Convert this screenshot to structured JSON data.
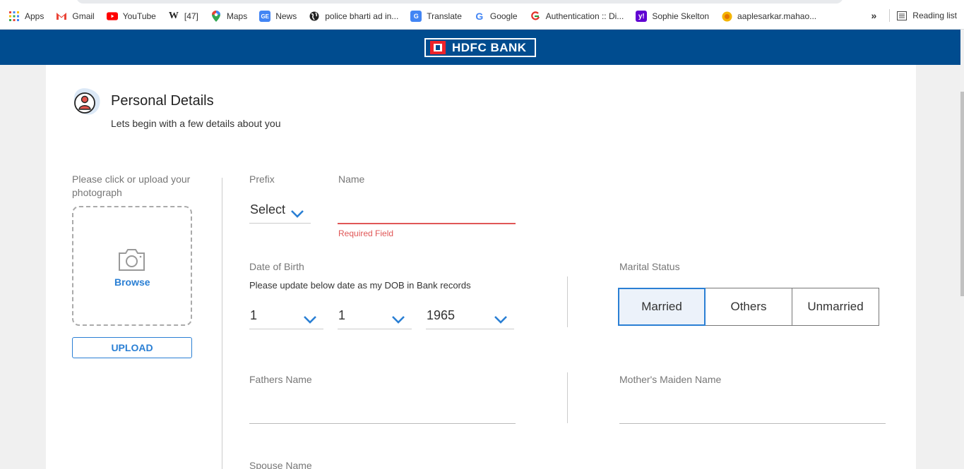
{
  "bookmarks": {
    "items": [
      {
        "label": "Apps",
        "icon": "apps-grid-icon"
      },
      {
        "label": "Gmail",
        "icon": "gmail-icon"
      },
      {
        "label": "YouTube",
        "icon": "youtube-icon"
      },
      {
        "label": "[47]",
        "icon": "wikipedia-icon"
      },
      {
        "label": "Maps",
        "icon": "maps-icon"
      },
      {
        "label": "News",
        "icon": "news-icon"
      },
      {
        "label": "police bharti ad in...",
        "icon": "globe-icon"
      },
      {
        "label": "Translate",
        "icon": "translate-icon"
      },
      {
        "label": "Google",
        "icon": "google-icon"
      },
      {
        "label": "Authentication :: Di...",
        "icon": "auth-icon"
      },
      {
        "label": "Sophie Skelton",
        "icon": "yahoo-icon"
      },
      {
        "label": "aaplesarkar.mahao...",
        "icon": "sun-icon"
      }
    ],
    "overflow": "»",
    "reading_list": "Reading list"
  },
  "header": {
    "logo_text": "HDFC BANK",
    "bg_color": "#004c8f"
  },
  "section": {
    "title": "Personal Details",
    "subtitle": "Lets begin with a few details about you"
  },
  "photo": {
    "label": "Please click or upload your photograph",
    "browse": "Browse",
    "upload": "UPLOAD"
  },
  "form": {
    "prefix_label": "Prefix",
    "prefix_value": "Select",
    "name_label": "Name",
    "name_value": "",
    "name_error": "Required Field",
    "dob_label": "Date of Birth",
    "dob_note": "Please update below date as my DOB in Bank records",
    "dob_day": "1",
    "dob_month": "1",
    "dob_year": "1965",
    "marital_label": "Marital Status",
    "marital_options": [
      "Married",
      "Others",
      "Unmarried"
    ],
    "marital_selected": "Married",
    "father_label": "Fathers Name",
    "mother_label": "Mother's Maiden Name",
    "spouse_label": "Spouse Name"
  },
  "colors": {
    "accent": "#2a7fd4",
    "error": "#e05656"
  }
}
